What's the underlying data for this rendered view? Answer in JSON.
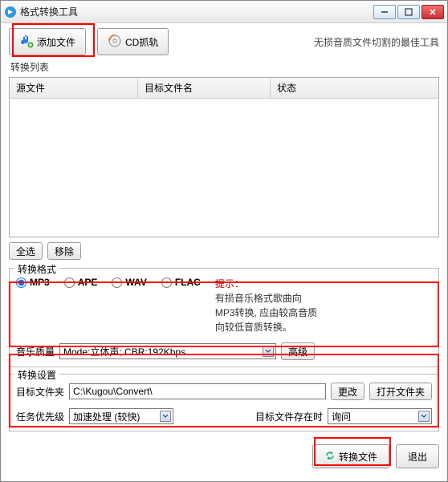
{
  "window": {
    "title": "格式转换工具"
  },
  "toolbar": {
    "add": "添加文件",
    "cd": "CD抓轨",
    "promo": "无损音质文件切割的最佳工具"
  },
  "list": {
    "label": "转换列表",
    "col1": "源文件",
    "col2": "目标文件名",
    "col3": "状态",
    "selectAll": "全选",
    "remove": "移除"
  },
  "format": {
    "label": "转换格式",
    "r1": "MP3",
    "r2": "APE",
    "r3": "WAV",
    "r4": "FLAC",
    "tipLabel": "提示：",
    "tipText": "有损音乐格式歌曲向MP3转换, 应由较高音质向较低音质转换。",
    "qualityLabel": "音乐质量",
    "qualityValue": "Mode:立体声; CBR:192Kbps",
    "advanced": "高级"
  },
  "settings": {
    "label": "转换设置",
    "dirLabel": "目标文件夹",
    "dirValue": "C:\\Kugou\\Convert\\",
    "change": "更改",
    "open": "打开文件夹",
    "priorityLabel": "任务优先级",
    "priorityValue": "加速处理 (较快)",
    "existsLabel": "目标文件存在时",
    "existsValue": "询问"
  },
  "footer": {
    "convert": "转换文件",
    "exit": "退出"
  }
}
